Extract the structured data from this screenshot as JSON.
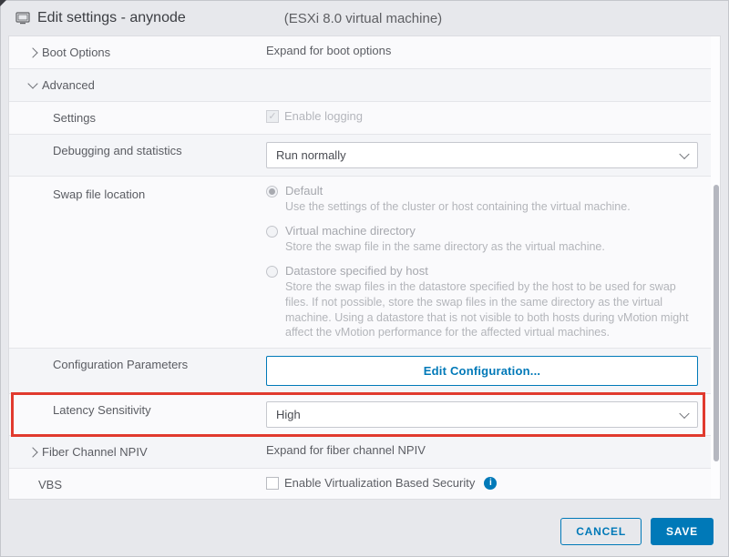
{
  "header": {
    "title": "Edit settings - anynode",
    "subtitle": "(ESXi 8.0 virtual machine)"
  },
  "rows": {
    "bootOptions": {
      "label": "Boot Options",
      "value": "Expand for boot options"
    },
    "advanced": {
      "label": "Advanced"
    },
    "settings": {
      "label": "Settings",
      "checkboxLabel": "Enable logging"
    },
    "debugging": {
      "label": "Debugging and statistics",
      "selected": "Run normally"
    },
    "swap": {
      "label": "Swap file location",
      "options": [
        {
          "title": "Default",
          "desc": "Use the settings of the cluster or host containing the virtual machine."
        },
        {
          "title": "Virtual machine directory",
          "desc": "Store the swap file in the same directory as the virtual machine."
        },
        {
          "title": "Datastore specified by host",
          "desc": "Store the swap files in the datastore specified by the host to be used for swap files. If not possible, store the swap files in the same directory as the virtual machine. Using a datastore that is not visible to both hosts during vMotion might affect the vMotion performance for the affected virtual machines."
        }
      ]
    },
    "configParams": {
      "label": "Configuration Parameters",
      "button": "Edit Configuration..."
    },
    "latency": {
      "label": "Latency Sensitivity",
      "selected": "High"
    },
    "fcnpiv": {
      "label": "Fiber Channel NPIV",
      "value": "Expand for fiber channel NPIV"
    },
    "vbs": {
      "label": "VBS",
      "checkboxLabel": "Enable Virtualization Based Security"
    }
  },
  "footer": {
    "cancel": "CANCEL",
    "save": "SAVE"
  }
}
